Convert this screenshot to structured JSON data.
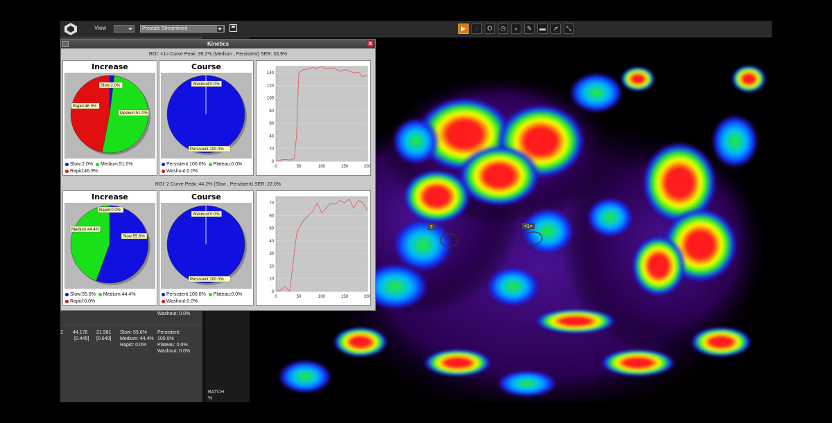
{
  "app": {
    "view_label": "View",
    "protocol": "Prostate Streamlined"
  },
  "toolbar": {
    "tools": [
      "play-icon",
      "lasso-icon",
      "ellipse-icon",
      "clock-icon",
      "zoom-icon",
      "pen-icon",
      "ruler-icon",
      "arrow-icon",
      "fit-icon"
    ]
  },
  "kinetics": {
    "title": "Kinetics",
    "close": "x",
    "rois": [
      {
        "header": "ROI: <1>   Curve Peak: 99.2% (Medium , Persistent)   SER: 33.9%",
        "increase_title": "Increase",
        "course_title": "Course",
        "increase_labels": {
          "slow": "Slow:2.0%",
          "medium": "Medium:51.0%",
          "rapid": "Rapid:46.9%"
        },
        "course_labels": {
          "washout": "Washout:0.0%",
          "persistent": "Persistent:100.0%"
        },
        "increase_legend": {
          "slow": "Slow:2.0%",
          "medium": "Medium:51.0%",
          "rapid": "Rapid:46.9%"
        },
        "course_legend": {
          "persistent": "Persistent:100.0%",
          "plateau": "Plateau:0.0%",
          "washout": "Washout:0.0%"
        },
        "increase_values": {
          "slow": 2.0,
          "medium": 51.0,
          "rapid": 46.9
        },
        "course_values": {
          "persistent": 100.0,
          "plateau": 0.0,
          "washout": 0.0
        },
        "chart_data": {
          "type": "line",
          "x": [
            0,
            10,
            20,
            30,
            40,
            45,
            50,
            60,
            70,
            80,
            90,
            100,
            110,
            120,
            130,
            140,
            150,
            160,
            170,
            180,
            190,
            200
          ],
          "y": [
            0,
            2,
            3,
            2,
            4,
            40,
            140,
            145,
            146,
            148,
            147,
            150,
            146,
            148,
            146,
            142,
            145,
            143,
            140,
            141,
            134,
            136
          ],
          "ylim": [
            0,
            150
          ],
          "yticks": [
            "0",
            "20",
            "40",
            "60",
            "80",
            "100",
            "120",
            "140"
          ],
          "xticks": [
            "0",
            "50",
            "100",
            "150",
            "200"
          ],
          "xlim": [
            0,
            200
          ],
          "color": "#e06060"
        }
      },
      {
        "header": "ROI: 2   Curve Peak: 44.2% (Slow , Persistent)   SER: 22.0%",
        "increase_title": "Increase",
        "course_title": "Course",
        "increase_labels": {
          "rapid": "Rapid:0.0%",
          "medium": "Medium:44.4%",
          "slow": "Slow:55.6%"
        },
        "course_labels": {
          "washout": "Washout:0.0%",
          "persistent": "Persistent:100.0%"
        },
        "increase_legend": {
          "slow": "Slow:55.6%",
          "medium": "Medium:44.4%",
          "rapid": "Rapid:0.0%"
        },
        "course_legend": {
          "persistent": "Persistent:100.0%",
          "plateau": "Plateau:0.0%",
          "washout": "Washout:0.0%"
        },
        "increase_values": {
          "slow": 55.6,
          "medium": 44.4,
          "rapid": 0.0
        },
        "course_values": {
          "persistent": 100.0,
          "plateau": 0.0,
          "washout": 0.0
        },
        "chart_data": {
          "type": "line",
          "x": [
            0,
            10,
            20,
            25,
            30,
            40,
            45,
            50,
            60,
            70,
            80,
            90,
            100,
            110,
            120,
            130,
            140,
            150,
            160,
            170,
            180,
            190,
            200
          ],
          "y": [
            0,
            1,
            4,
            2,
            0,
            30,
            45,
            50,
            56,
            60,
            63,
            70,
            62,
            66,
            70,
            69,
            72,
            70,
            73,
            66,
            72,
            70,
            64
          ],
          "ylim": [
            0,
            75
          ],
          "yticks": [
            "0",
            "10",
            "20",
            "30",
            "40",
            "50",
            "60",
            "70"
          ],
          "xticks": [
            "0",
            "50",
            "100",
            "150",
            "200"
          ],
          "xlim": [
            0,
            200
          ],
          "color": "#e06060"
        }
      }
    ]
  },
  "panel": {
    "washout_label": "Washout: 0.0%",
    "row": {
      "id": "2",
      "v1": "44.176",
      "v1b": "[0.445]",
      "v2": "21.981",
      "v2b": "[0.649]",
      "inc1": "Slow: 55.6%",
      "inc2": "Medium: 44.4%",
      "inc3": "Rapid: 0.0%",
      "c1": "Persistent:",
      "c1b": "100.0%",
      "c2": "Plateau: 0.0%",
      "c3": "Washout: 0.0%"
    },
    "batch": "BATCH",
    "batch2": "%"
  },
  "mri": {
    "roi_label_1": "<1>",
    "roi_label_2": "2"
  },
  "colors": {
    "slow": "#1010e0",
    "medium": "#19e019",
    "rapid": "#e01010",
    "accent": "#e07a10"
  }
}
